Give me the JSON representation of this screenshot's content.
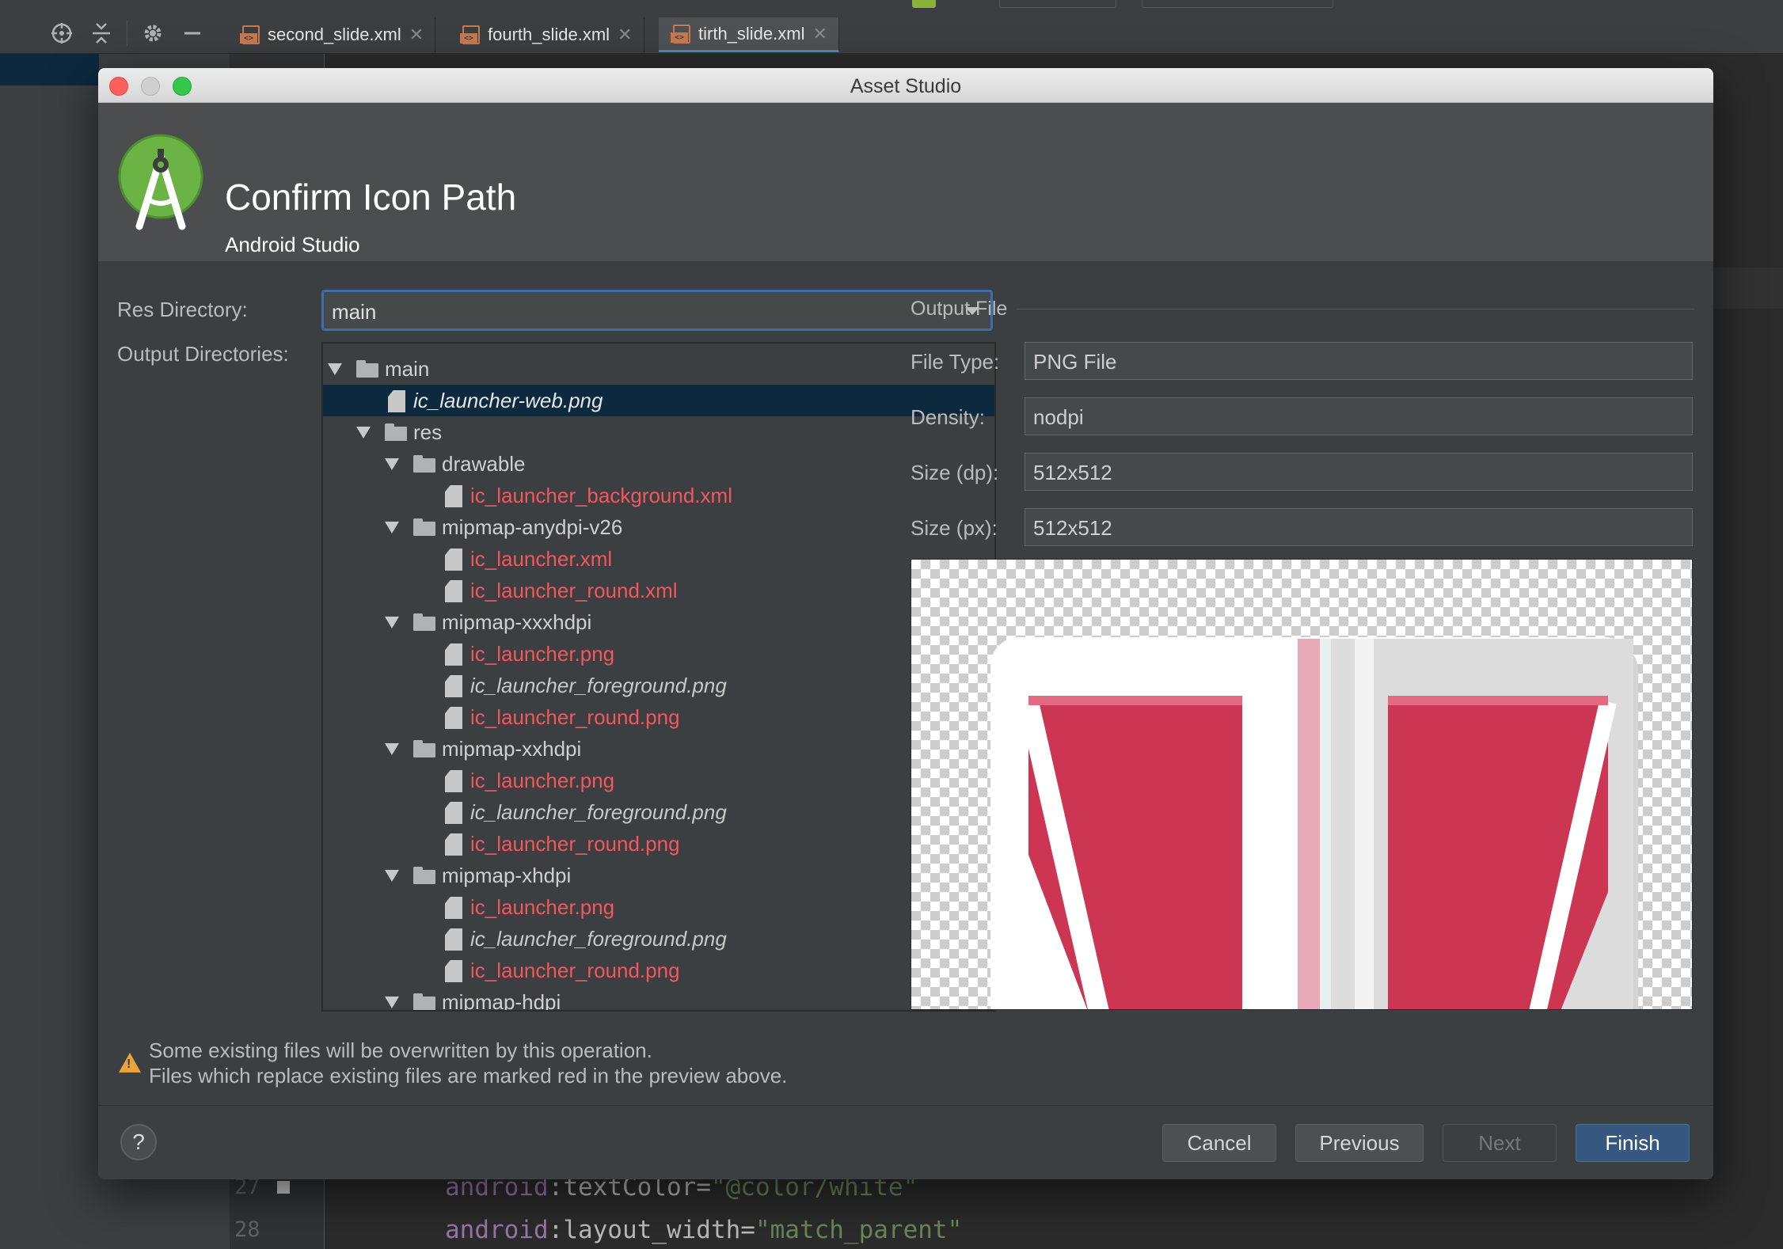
{
  "ide": {
    "tabs": [
      {
        "label": "second_slide.xml"
      },
      {
        "label": "fourth_slide.xml"
      },
      {
        "label": "tirth_slide.xml"
      }
    ],
    "code_lines": [
      {
        "number": "27",
        "attr": "android",
        "name": ":textColor=",
        "value": "\"@color/white\""
      },
      {
        "number": "28",
        "attr": "android",
        "name": ":layout_width=",
        "value": "\"match_parent\""
      }
    ]
  },
  "dialog": {
    "window_title": "Asset Studio",
    "header_title": "Confirm Icon Path",
    "header_subtitle": "Android Studio",
    "res_directory_label": "Res Directory:",
    "res_directory_value": "main",
    "output_directories_label": "Output Directories:",
    "tree": [
      {
        "label": "main",
        "kind": "folder"
      },
      {
        "label": "ic_launcher-web.png",
        "kind": "file",
        "selected": true
      },
      {
        "label": "res",
        "kind": "folder"
      },
      {
        "label": "drawable",
        "kind": "folder"
      },
      {
        "label": "ic_launcher_background.xml",
        "kind": "file",
        "overwrite": true
      },
      {
        "label": "mipmap-anydpi-v26",
        "kind": "folder"
      },
      {
        "label": "ic_launcher.xml",
        "kind": "file",
        "overwrite": true
      },
      {
        "label": "ic_launcher_round.xml",
        "kind": "file",
        "overwrite": true
      },
      {
        "label": "mipmap-xxxhdpi",
        "kind": "folder"
      },
      {
        "label": "ic_launcher.png",
        "kind": "file",
        "overwrite": true
      },
      {
        "label": "ic_launcher_foreground.png",
        "kind": "file"
      },
      {
        "label": "ic_launcher_round.png",
        "kind": "file",
        "overwrite": true
      },
      {
        "label": "mipmap-xxhdpi",
        "kind": "folder"
      },
      {
        "label": "ic_launcher.png",
        "kind": "file",
        "overwrite": true
      },
      {
        "label": "ic_launcher_foreground.png",
        "kind": "file"
      },
      {
        "label": "ic_launcher_round.png",
        "kind": "file",
        "overwrite": true
      },
      {
        "label": "mipmap-xhdpi",
        "kind": "folder"
      },
      {
        "label": "ic_launcher.png",
        "kind": "file",
        "overwrite": true
      },
      {
        "label": "ic_launcher_foreground.png",
        "kind": "file"
      },
      {
        "label": "ic_launcher_round.png",
        "kind": "file",
        "overwrite": true
      },
      {
        "label": "mipmap-hdpi",
        "kind": "folder"
      }
    ],
    "output_file": {
      "section_title": "Output File",
      "file_type_label": "File Type:",
      "file_type_value": "PNG File",
      "density_label": "Density:",
      "density_value": "nodpi",
      "size_dp_label": "Size (dp):",
      "size_dp_value": "512x512",
      "size_px_label": "Size (px):",
      "size_px_value": "512x512"
    },
    "warning_line1": "Some existing files will be overwritten by this operation.",
    "warning_line2": "Files which replace existing files are marked red in the preview above.",
    "help_label": "?",
    "buttons": {
      "cancel": "Cancel",
      "previous": "Previous",
      "next": "Next",
      "finish": "Finish"
    }
  },
  "colors": {
    "overwrite_red": "#f2575b",
    "selection": "#0d293e",
    "primary_button": "#365880",
    "preview_icon_red": "#cc3652"
  },
  "icons": [
    "crosshair-icon",
    "collapse-icon",
    "gear-icon",
    "minimize-icon",
    "xml-file-icon",
    "close-icon",
    "folder-icon",
    "file-icon",
    "triangle-expand-icon",
    "chevron-down-icon",
    "warning-icon",
    "help-icon",
    "android-studio-logo"
  ]
}
